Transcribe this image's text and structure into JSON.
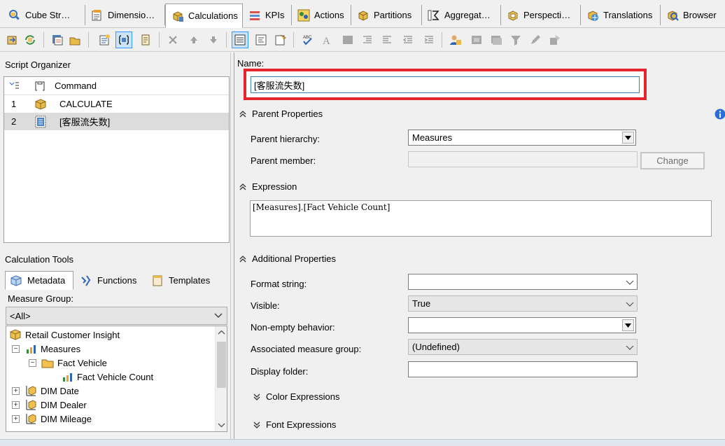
{
  "tabs": [
    {
      "label": "Cube Str…",
      "icon": "cube-structure-icon",
      "active": false
    },
    {
      "label": "Dimensio…",
      "icon": "dimension-usage-icon",
      "active": false
    },
    {
      "label": "Calculations",
      "icon": "calculations-icon",
      "active": true
    },
    {
      "label": "KPIs",
      "icon": "kpis-icon",
      "active": false
    },
    {
      "label": "Actions",
      "icon": "actions-icon",
      "active": false
    },
    {
      "label": "Partitions",
      "icon": "partitions-icon",
      "active": false
    },
    {
      "label": "Aggregat…",
      "icon": "aggregations-icon",
      "active": false
    },
    {
      "label": "Perspecti…",
      "icon": "perspectives-icon",
      "active": false
    },
    {
      "label": "Translations",
      "icon": "translations-icon",
      "active": false
    },
    {
      "label": "Browser",
      "icon": "browser-icon",
      "active": false
    }
  ],
  "left": {
    "script_organizer_title": "Script Organizer",
    "organizer_header": "Command",
    "organizer_rows": [
      {
        "num": "1",
        "text": "CALCULATE",
        "icon": "calculate-icon"
      },
      {
        "num": "2",
        "text": "[客服流失数]",
        "icon": "calculated-member-icon"
      }
    ],
    "calc_tools_title": "Calculation Tools",
    "tool_tabs": [
      {
        "label": "Metadata",
        "icon": "metadata-icon"
      },
      {
        "label": "Functions",
        "icon": "functions-icon"
      },
      {
        "label": "Templates",
        "icon": "templates-icon"
      }
    ],
    "measure_group_label": "Measure Group:",
    "measure_group_value": "<All>",
    "tree": [
      {
        "text": "Retail Customer Insight",
        "icon": "cube-icon"
      },
      {
        "text": "Measures",
        "icon": "measures-icon"
      },
      {
        "text": "Fact Vehicle",
        "icon": "folder-icon"
      },
      {
        "text": "Fact Vehicle Count",
        "icon": "measure-icon"
      },
      {
        "text": "DIM Date",
        "icon": "dimension-icon"
      },
      {
        "text": "DIM Dealer",
        "icon": "dimension-icon"
      },
      {
        "text": "DIM Mileage",
        "icon": "dimension-icon"
      }
    ]
  },
  "right": {
    "name_label": "Name:",
    "name_value": "[客服流失数]",
    "parent_properties": "Parent Properties",
    "parent_hierarchy_label": "Parent hierarchy:",
    "parent_hierarchy_value": "Measures",
    "parent_member_label": "Parent member:",
    "parent_member_value": "",
    "change_button": "Change",
    "expression_title": "Expression",
    "expression_value": "[Measures].[Fact Vehicle Count]",
    "additional_properties": "Additional Properties",
    "format_string_label": "Format string:",
    "format_string_value": "",
    "visible_label": "Visible:",
    "visible_value": "True",
    "non_empty_label": "Non-empty behavior:",
    "non_empty_value": "",
    "assoc_label": "Associated measure group:",
    "assoc_value": "(Undefined)",
    "display_folder_label": "Display folder:",
    "display_folder_value": "",
    "color_expressions": "Color Expressions",
    "font_expressions": "Font Expressions"
  }
}
